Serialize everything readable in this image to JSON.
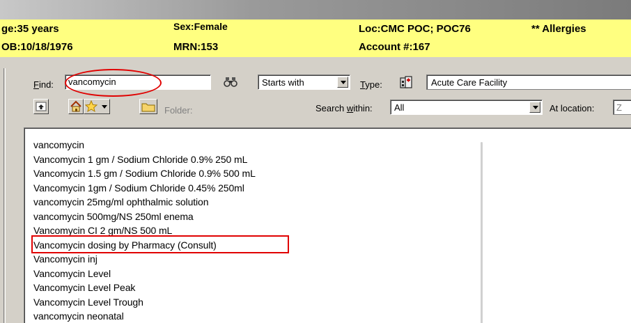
{
  "banner": {
    "age": "ge:35 years",
    "dob": "OB:10/18/1976",
    "sex": "Sex:Female",
    "mrn": "MRN:153",
    "location": "Loc:CMC POC; POC76",
    "account": "Account #:167",
    "allergies": "** Allergies"
  },
  "search": {
    "find_label_accel": "F",
    "find_label_rest": "ind:",
    "find_value": "vancomycin",
    "match_mode": "Starts with",
    "type_label_accel": "T",
    "type_label_rest": "ype:",
    "type_value": "Acute Care Facility",
    "folder_label": "Folder:",
    "search_within_prefix": "Search ",
    "search_within_accel": "w",
    "search_within_suffix": "ithin:",
    "search_within_value": "All",
    "at_location_label": "At location:",
    "at_location_value": "Z"
  },
  "results": [
    "vancomycin",
    "Vancomycin 1 gm / Sodium Chloride 0.9% 250 mL",
    "Vancomycin 1.5 gm / Sodium Chloride 0.9% 500 mL",
    "Vancomycin 1gm / Sodium Chloride 0.45% 250ml",
    "vancomycin 25mg/ml ophthalmic solution",
    "vancomycin 500mg/NS 250ml enema",
    "Vancomycin CI 2 gm/NS 500 mL",
    "Vancomycin dosing by Pharmacy (Consult)",
    "Vancomycin inj",
    "Vancomycin Level",
    "Vancomycin Level Peak",
    "Vancomycin Level Trough",
    "vancomycin neonatal"
  ],
  "colors": {
    "banner": "#ffff80",
    "annotation": "#e00000",
    "panel": "#d4d0c8"
  },
  "icons": {
    "binoculars": "binoculars-icon",
    "type": "facility-icon",
    "up": "up-folder-icon",
    "home": "home-icon",
    "favorites": "star-icon",
    "folder": "folder-icon"
  }
}
